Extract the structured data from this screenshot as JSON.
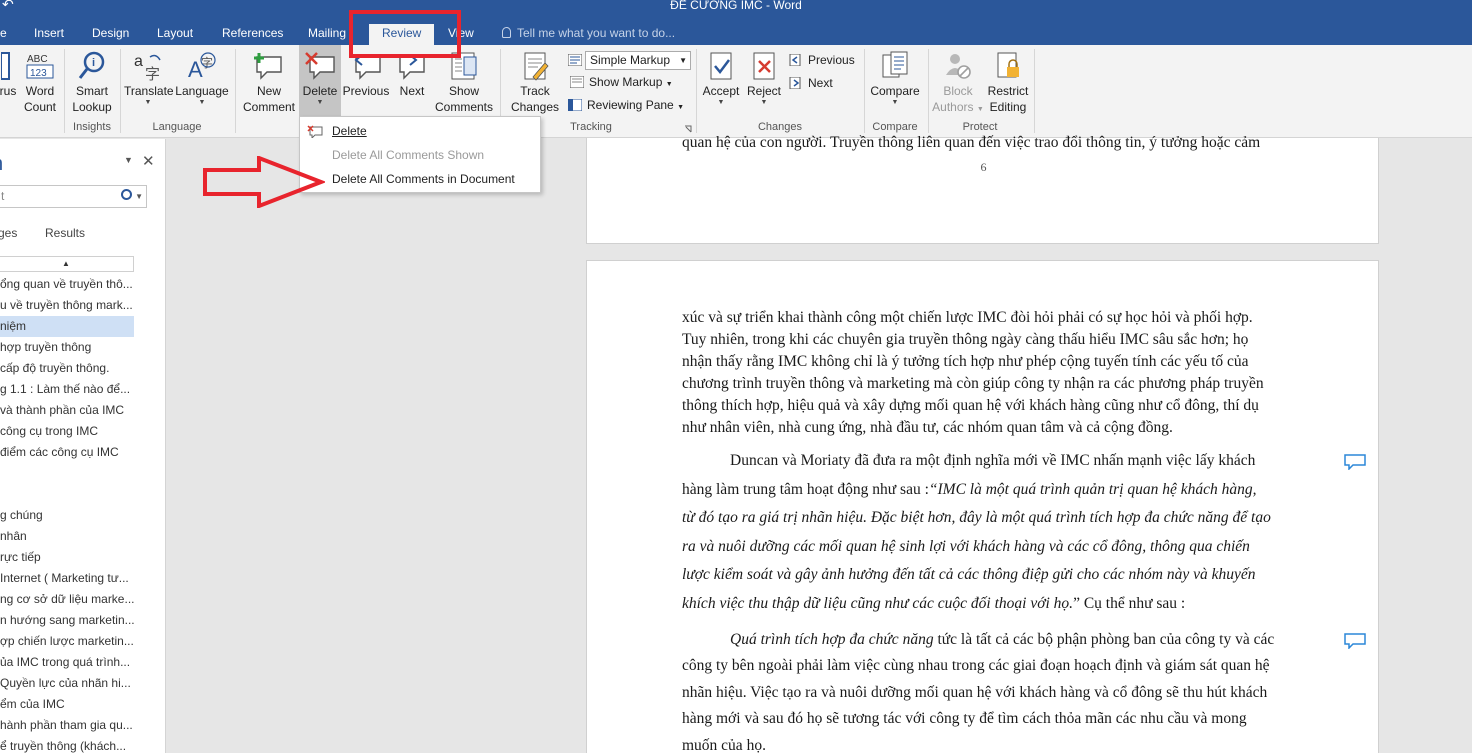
{
  "window": {
    "title": "ĐỀ CƯƠNG IMC - Word"
  },
  "tabs": [
    {
      "label": "e",
      "active": false
    },
    {
      "label": "Insert",
      "active": false
    },
    {
      "label": "Design",
      "active": false
    },
    {
      "label": "Layout",
      "active": false
    },
    {
      "label": "References",
      "active": false
    },
    {
      "label": "Mailing",
      "active": false
    },
    {
      "label": "Review",
      "active": true
    },
    {
      "label": "View",
      "active": false
    }
  ],
  "tell_me": "Tell me what you want to do...",
  "ribbon": {
    "proofing": {
      "thesaurus_partial": "rus",
      "word_count": [
        "Word",
        "Count"
      ]
    },
    "insights": {
      "smart_lookup": [
        "Smart",
        "Lookup"
      ],
      "group": "Insights"
    },
    "language": {
      "translate": "Translate",
      "language": "Language",
      "group": "Language"
    },
    "comments": {
      "new_comment": [
        "New",
        "Comment"
      ],
      "delete": "Delete",
      "previous": "Previous",
      "next": "Next",
      "show_comments": [
        "Show",
        "Comments"
      ]
    },
    "tracking": {
      "track_changes": [
        "Track",
        "Changes"
      ],
      "markup_select": "Simple Markup",
      "show_markup": "Show Markup",
      "reviewing_pane": "Reviewing Pane",
      "group": "Tracking"
    },
    "changes": {
      "accept": "Accept",
      "reject": "Reject",
      "previous": "Previous",
      "next": "Next",
      "group": "Changes"
    },
    "compare": {
      "compare": "Compare",
      "group": "Compare"
    },
    "protect": {
      "block_authors": [
        "Block",
        "Authors"
      ],
      "restrict_editing": [
        "Restrict",
        "Editing"
      ],
      "group": "Protect"
    }
  },
  "delete_menu": {
    "items": [
      {
        "label": "Delete",
        "enabled": true
      },
      {
        "label": "Delete All Comments Shown",
        "enabled": false
      },
      {
        "label": "Delete All Comments in Document",
        "enabled": true
      }
    ]
  },
  "nav_pane": {
    "title": "n",
    "search_value": "t",
    "tabs": [
      "ges",
      "Results"
    ],
    "items": [
      "ổng quan về truyền thô...",
      "u về truyền thông mark...",
      " niệm",
      " hợp truyền thông",
      " cấp độ truyền thông.",
      "g 1.1 : Làm thế nào để...",
      " và thành phần của IMC",
      " công cụ trong IMC",
      " điểm các công cụ IMC",
      "",
      "",
      " g chúng",
      " nhân",
      "rực tiếp",
      " Internet ( Marketing tư...",
      "ng cơ sở dữ liệu marke...",
      "n hướng sang marketin...",
      "ợp chiến lược marketin...",
      "ủa IMC trong quá trình...",
      " Quyền lực của nhãn hi...",
      "ểm của IMC",
      "hành phần tham gia qu...",
      "ể truyền thông (khách..."
    ]
  },
  "document": {
    "prev_page_last_line": "quan hệ của con người. Truyền thông liên quan đến việc trao đổi thông tin, ý tưởng hoặc cảm",
    "page_number": "6",
    "para1": [
      "xúc và sự triển khai thành công một chiến lược IMC đòi hỏi phải có sự học hỏi và phối hợp.",
      "Tuy nhiên, trong khi các chuyên gia truyền thông ngày càng thấu hiểu IMC sâu sắc hơn; họ",
      "nhận thấy rằng IMC không chỉ là ý tưởng tích hợp như phép cộng tuyến tính các yếu tố của",
      "chương trình truyền thông và marketing mà còn giúp công ty nhận ra các phương pháp truyền",
      "thông thích hợp, hiệu quả và xây dựng mối quan hệ với khách hàng cũng như cổ đông, thí dụ",
      "như nhân viên, nhà cung ứng, nhà đầu tư, các nhóm quan tâm và cả cộng đồng."
    ],
    "para2_line1": "Duncan và Moriaty đã đưa ra một định nghĩa mới về IMC nhấn mạnh việc lấy khách",
    "para2_line2_normal": "hàng làm trung tâm hoạt động như sau :",
    "para2_line2_italic": "“IMC là một quá trình quản trị quan hệ khách hàng,",
    "para2_italic_lines": [
      "từ đó tạo ra giá trị nhãn hiệu. Đặc biệt hơn, đây là một quá trình tích hợp đa chức năng để tạo",
      "ra và nuôi dưỡng các mối quan hệ sinh lợi với khách hàng và các cổ đông, thông qua chiến",
      "lược kiểm soát và gây ảnh hưởng đến tất cả các thông điệp gửi cho các nhóm này và khuyến"
    ],
    "para2_last_italic": "khích việc thu thập dữ liệu cũng như các cuộc đối thoại với họ.",
    "para2_last_normal": "” Cụ thể như sau :",
    "para3_line1_italic": "Quá trình tích hợp đa chức năng",
    "para3_line1_normal": " tức là tất cả các bộ phận phòng ban của công ty và các",
    "para3_lines": [
      "công ty bên ngoài phải làm việc cùng nhau trong các giai đoạn hoạch định và giám sát quan hệ",
      "nhãn hiệu. Việc tạo ra và nuôi dưỡng mối quan hệ với khách hàng và cổ đông sẽ thu hút khách",
      "hàng mới và sau đó họ sẽ tương tác với công ty để tìm cách thỏa mãn các nhu cầu và mong",
      "muốn của họ."
    ]
  },
  "colors": {
    "word_blue": "#2b579a",
    "highlight_red": "#e8242d",
    "selected_gray": "#c5c5c5"
  }
}
